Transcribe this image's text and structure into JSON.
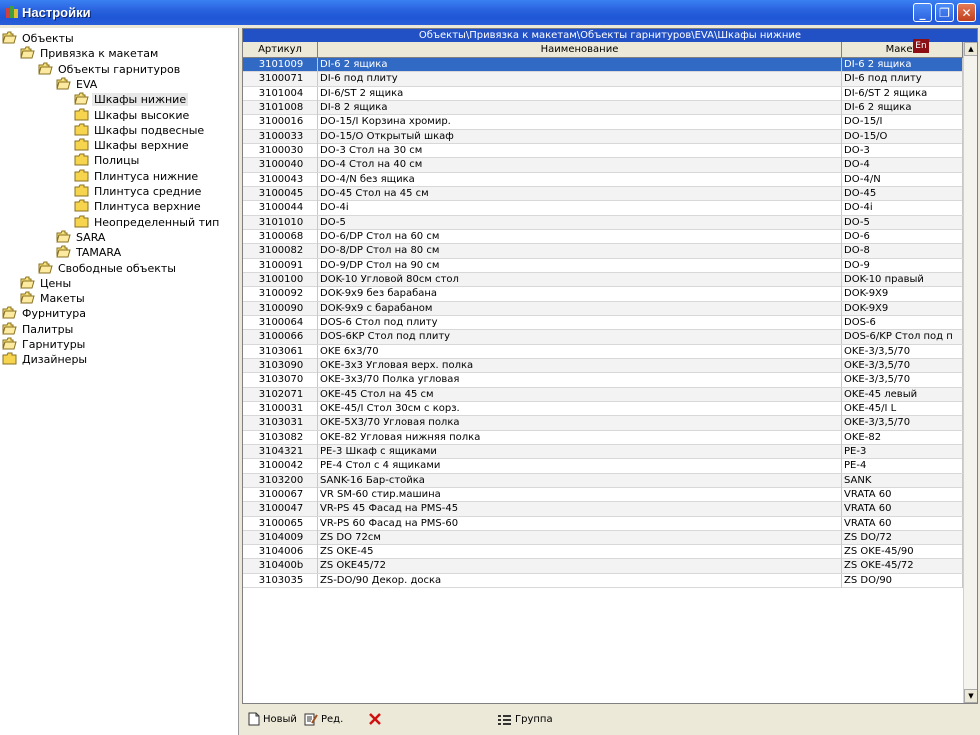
{
  "window": {
    "title": "Настройки"
  },
  "lang_badge": "En",
  "tree": [
    {
      "label": "Объекты",
      "level": 0,
      "icon": "folder-open-icon"
    },
    {
      "label": "Привязка к макетам",
      "level": 1,
      "icon": "folder-open-icon"
    },
    {
      "label": "Объекты гарнитуров",
      "level": 2,
      "icon": "folder-open-icon"
    },
    {
      "label": "EVA",
      "level": 3,
      "icon": "folder-open-icon"
    },
    {
      "label": "Шкафы нижние",
      "level": 4,
      "icon": "folder-open-icon",
      "selected": true
    },
    {
      "label": "Шкафы высокие",
      "level": 4,
      "icon": "folder-icon"
    },
    {
      "label": "Шкафы подвесные",
      "level": 4,
      "icon": "folder-icon"
    },
    {
      "label": "Шкафы верхние",
      "level": 4,
      "icon": "folder-icon"
    },
    {
      "label": "Полицы",
      "level": 4,
      "icon": "folder-icon"
    },
    {
      "label": "Плинтуса нижние",
      "level": 4,
      "icon": "folder-icon"
    },
    {
      "label": "Плинтуса средние",
      "level": 4,
      "icon": "folder-icon"
    },
    {
      "label": "Плинтуса верхние",
      "level": 4,
      "icon": "folder-icon"
    },
    {
      "label": "Неопределенный тип",
      "level": 4,
      "icon": "folder-icon"
    },
    {
      "label": "SARA",
      "level": 3,
      "icon": "folder-open-icon"
    },
    {
      "label": "TAMARA",
      "level": 3,
      "icon": "folder-open-icon"
    },
    {
      "label": "Свободные объекты",
      "level": 2,
      "icon": "folder-open-icon"
    },
    {
      "label": "Цены",
      "level": 1,
      "icon": "folder-open-icon"
    },
    {
      "label": "Макеты",
      "level": 1,
      "icon": "folder-open-icon"
    },
    {
      "label": "Фурнитура",
      "level": 0,
      "icon": "folder-open-icon"
    },
    {
      "label": "Палитры",
      "level": 0,
      "icon": "folder-open-icon"
    },
    {
      "label": "Гарнитуры",
      "level": 0,
      "icon": "folder-open-icon"
    },
    {
      "label": "Дизайнеры",
      "level": 0,
      "icon": "folder-icon"
    }
  ],
  "grid": {
    "path": "Объекты\\Привязка к макетам\\Объекты гарнитуров\\EVA\\Шкафы нижние",
    "columns": [
      "Артикул",
      "Наименование",
      "Макет"
    ],
    "rows": [
      [
        "3101009",
        "DI-6 2 ящика",
        "DI-6 2 ящика"
      ],
      [
        "3100071",
        "DI-6 под плиту",
        "DI-6 под плиту"
      ],
      [
        "3101004",
        "DI-6/ST 2 ящика",
        "DI-6/ST 2 ящика"
      ],
      [
        "3101008",
        "DI-8 2 ящика",
        "DI-6 2 ящика"
      ],
      [
        "3100016",
        "DO-15/I Корзина хромир.",
        "DO-15/I"
      ],
      [
        "3100033",
        "DO-15/O Открытый шкаф",
        "DO-15/O"
      ],
      [
        "3100030",
        "DO-3 Стол на 30 см",
        "DO-3"
      ],
      [
        "3100040",
        "DO-4 Стол на 40 см",
        "DO-4"
      ],
      [
        "3100043",
        "DO-4/N без ящика",
        "DO-4/N"
      ],
      [
        "3100045",
        "DO-45 Стол на 45 см",
        "DO-45"
      ],
      [
        "3100044",
        "DO-4i",
        "DO-4i"
      ],
      [
        "3101010",
        "DO-5",
        "DO-5"
      ],
      [
        "3100068",
        "DO-6/DP Стол на 60 см",
        "DO-6"
      ],
      [
        "3100082",
        "DO-8/DP Стол на 80 см",
        "DO-8"
      ],
      [
        "3100091",
        "DO-9/DP Стол на 90 см",
        "DO-9"
      ],
      [
        "3100100",
        "DOK-10 Угловой 80см стол",
        "DOK-10 правый"
      ],
      [
        "3100092",
        "DOK-9x9 без барабана",
        "DOK-9X9"
      ],
      [
        "3100090",
        "DOK-9x9 с  барабаном",
        "DOK-9X9"
      ],
      [
        "3100064",
        "DOS-6 Стол под плиту",
        "DOS-6"
      ],
      [
        "3100066",
        "DOS-6KP Стол под плиту",
        "DOS-6/KP Стол под п"
      ],
      [
        "3103061",
        "OKE 6x3/70",
        "OKE-3/3,5/70"
      ],
      [
        "3103090",
        "OKE-3x3 Угловая верх. полка",
        "OKE-3/3,5/70"
      ],
      [
        "3103070",
        "OKE-3x3/70 Полка угловая",
        "OKE-3/3,5/70"
      ],
      [
        "3102071",
        "OKE-45 Стол на 45 см",
        "OKE-45 левый"
      ],
      [
        "3100031",
        "OKE-45/I Стол 30см с корз.",
        "OKE-45/I L"
      ],
      [
        "3103031",
        "OKE-5X3/70 Угловая полка",
        "OKE-3/3,5/70"
      ],
      [
        "3103082",
        "OKE-82 Угловая нижняя полка",
        "OKE-82"
      ],
      [
        "3104321",
        "PE-3 Шкаф с ящиками",
        "PE-3"
      ],
      [
        "3100042",
        "PE-4 Стол с 4 ящиками",
        "PE-4"
      ],
      [
        "3103200",
        "SANK-16 Бар-стойка",
        "SANK"
      ],
      [
        "3100067",
        "VR SM-60 стир.машина",
        "VRATA 60"
      ],
      [
        "3100047",
        "VR-PS 45 Фасад на PMS-45",
        "VRATA 60"
      ],
      [
        "3100065",
        "VR-PS 60 Фасад на PMS-60",
        "VRATA 60"
      ],
      [
        "3104009",
        "ZS DO 72см",
        "ZS DO/72"
      ],
      [
        "3104006",
        "ZS OKE-45",
        "ZS OKE-45/90"
      ],
      [
        "310400b",
        "ZS OKE45/72",
        "ZS OKE-45/72"
      ],
      [
        "3103035",
        "ZS-DO/90 Декор. доска",
        "ZS DO/90"
      ]
    ],
    "selected_row": 0
  },
  "toolbar": {
    "new_label": "Новый",
    "edit_label": "Ред.",
    "delete_icon": "red-x-icon",
    "group_label": "Группа"
  },
  "colors": {
    "title_bar": "#2a63de",
    "selection": "#316ac5",
    "path_bar": "#2251c6",
    "badge": "#8b0f14"
  }
}
